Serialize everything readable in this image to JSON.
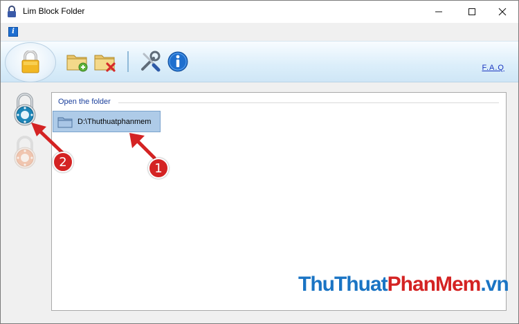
{
  "window": {
    "title": "Lim Block Folder",
    "controls": {
      "minimize": "minimize",
      "maximize": "maximize",
      "close": "close"
    }
  },
  "menu": {
    "about_icon": "i"
  },
  "toolbar": {
    "icons": [
      "lock-icon",
      "add-folder-icon",
      "remove-folder-icon",
      "tools-icon",
      "info-icon"
    ],
    "faq_label": "F.A.Q"
  },
  "rail": {
    "icons": [
      "unlock-dial-icon",
      "lock-dial-icon"
    ]
  },
  "folder_group": {
    "title": "Open the folder",
    "items": [
      {
        "path": "D:\\Thuthuatphanmem",
        "selected": true
      }
    ]
  },
  "annotations": {
    "badges": [
      "1",
      "2"
    ],
    "color": "#d42323"
  },
  "watermark": {
    "parts": [
      "ThuThuat",
      "PhanMem",
      ".vn"
    ],
    "colors": [
      "#1a74c4",
      "#d42323",
      "#1a74c4"
    ]
  }
}
